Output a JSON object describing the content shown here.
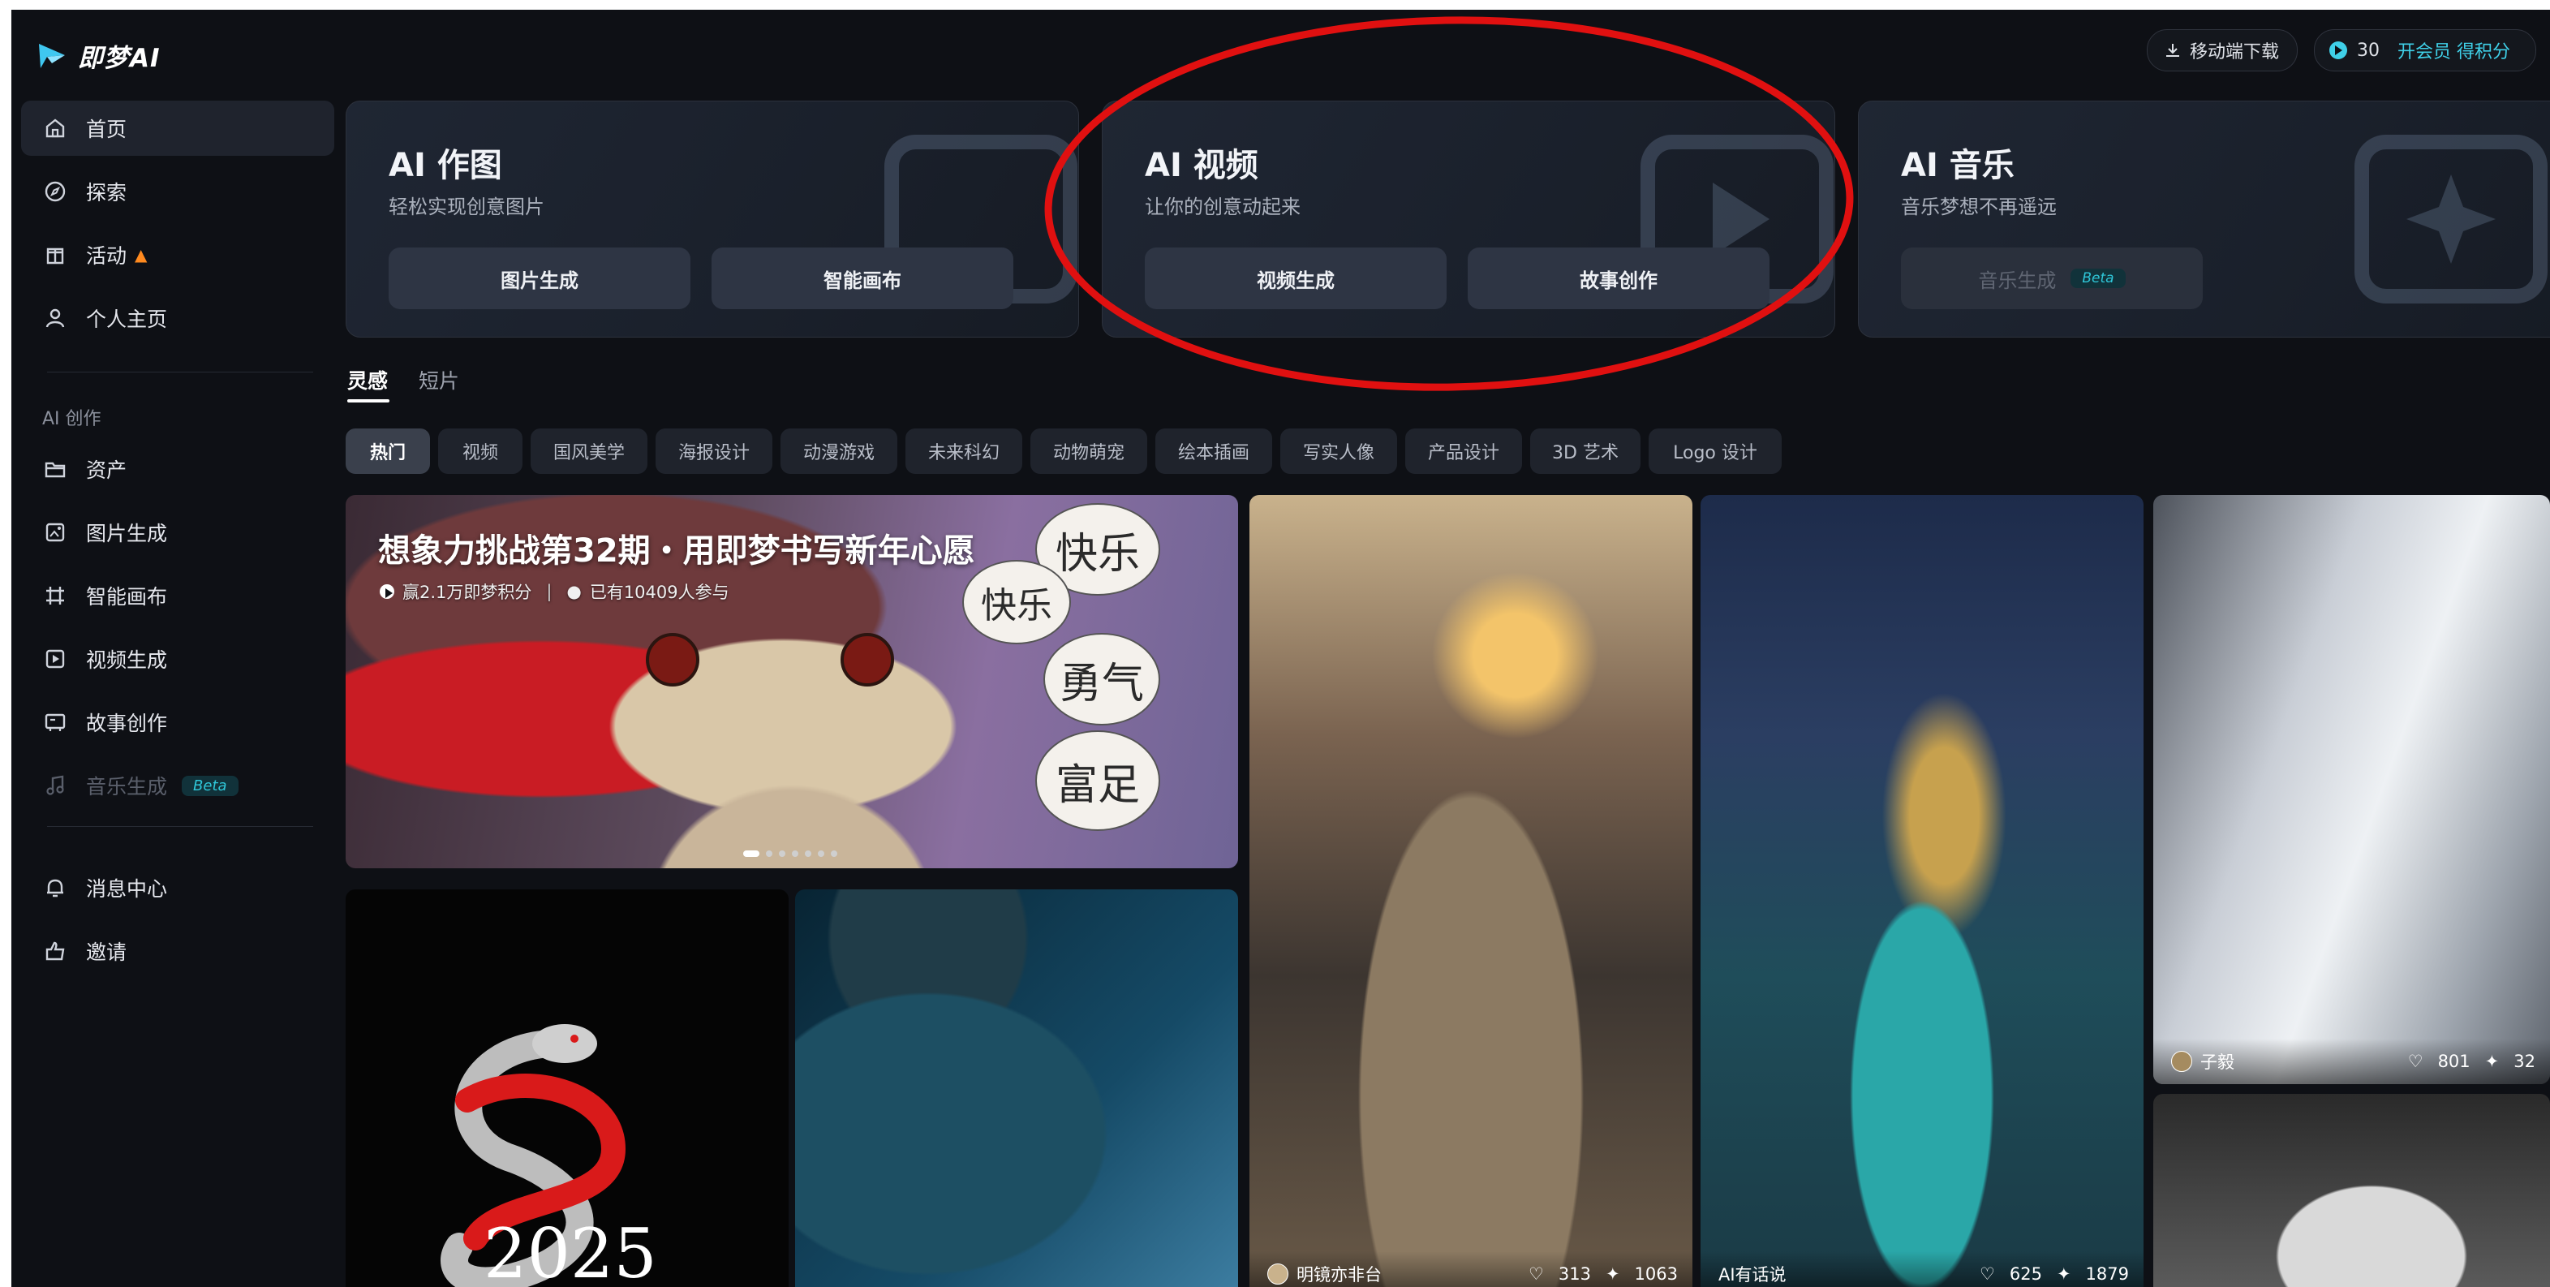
{
  "app": {
    "brand": "即梦AI"
  },
  "sidebar": {
    "primary": [
      {
        "label": "首页",
        "icon": "home-icon"
      },
      {
        "label": "探索",
        "icon": "compass-icon"
      },
      {
        "label": "活动",
        "icon": "gift-icon"
      },
      {
        "label": "个人主页",
        "icon": "user-icon"
      }
    ],
    "section_title": "AI 创作",
    "creation": [
      {
        "label": "资产",
        "icon": "folder-icon"
      },
      {
        "label": "图片生成",
        "icon": "image-gen-icon"
      },
      {
        "label": "智能画布",
        "icon": "canvas-icon"
      },
      {
        "label": "视频生成",
        "icon": "video-gen-icon"
      },
      {
        "label": "故事创作",
        "icon": "story-icon"
      },
      {
        "label": "音乐生成",
        "icon": "music-icon",
        "badge": "Beta"
      }
    ],
    "bottom": [
      {
        "label": "消息中心",
        "icon": "bell-icon"
      },
      {
        "label": "邀请",
        "icon": "invite-icon"
      }
    ]
  },
  "topbar": {
    "download_label": "移动端下载",
    "points": "30",
    "vip_label": "开会员 得积分"
  },
  "features": [
    {
      "title": "AI 作图",
      "subtitle": "轻松实现创意图片",
      "buttons": [
        "图片生成",
        "智能画布"
      ]
    },
    {
      "title": "AI 视频",
      "subtitle": "让你的创意动起来",
      "buttons": [
        "视频生成",
        "故事创作"
      ]
    },
    {
      "title": "AI 音乐",
      "subtitle": "音乐梦想不再遥远",
      "buttons": [
        "音乐生成"
      ],
      "badge": "Beta"
    }
  ],
  "tabs": [
    "灵感",
    "短片"
  ],
  "categories": [
    "热门",
    "视频",
    "国风美学",
    "海报设计",
    "动漫游戏",
    "未来科幻",
    "动物萌宠",
    "绘本插画",
    "写实人像",
    "产品设计",
    "3D 艺术",
    "Logo 设计"
  ],
  "banner": {
    "title": "想象力挑战第32期・用即梦书写新年心愿",
    "reward": "赢2.1万即梦积分",
    "participants": "已有10409人参与",
    "bubbles": [
      "快乐",
      "快乐",
      "勇气",
      "富足"
    ]
  },
  "gallery": {
    "snake_caption": "2025",
    "cards": [
      {
        "author": "明镜亦非台",
        "likes": "313",
        "remixes": "1063"
      },
      {
        "author": "AI有话说",
        "likes": "625",
        "remixes": "1879"
      },
      {
        "author": "子毅",
        "likes": "801",
        "remixes": "32"
      }
    ]
  },
  "colors": {
    "background": "#0e1015",
    "accent": "#3fd0e8",
    "annotation": "#e01010"
  }
}
